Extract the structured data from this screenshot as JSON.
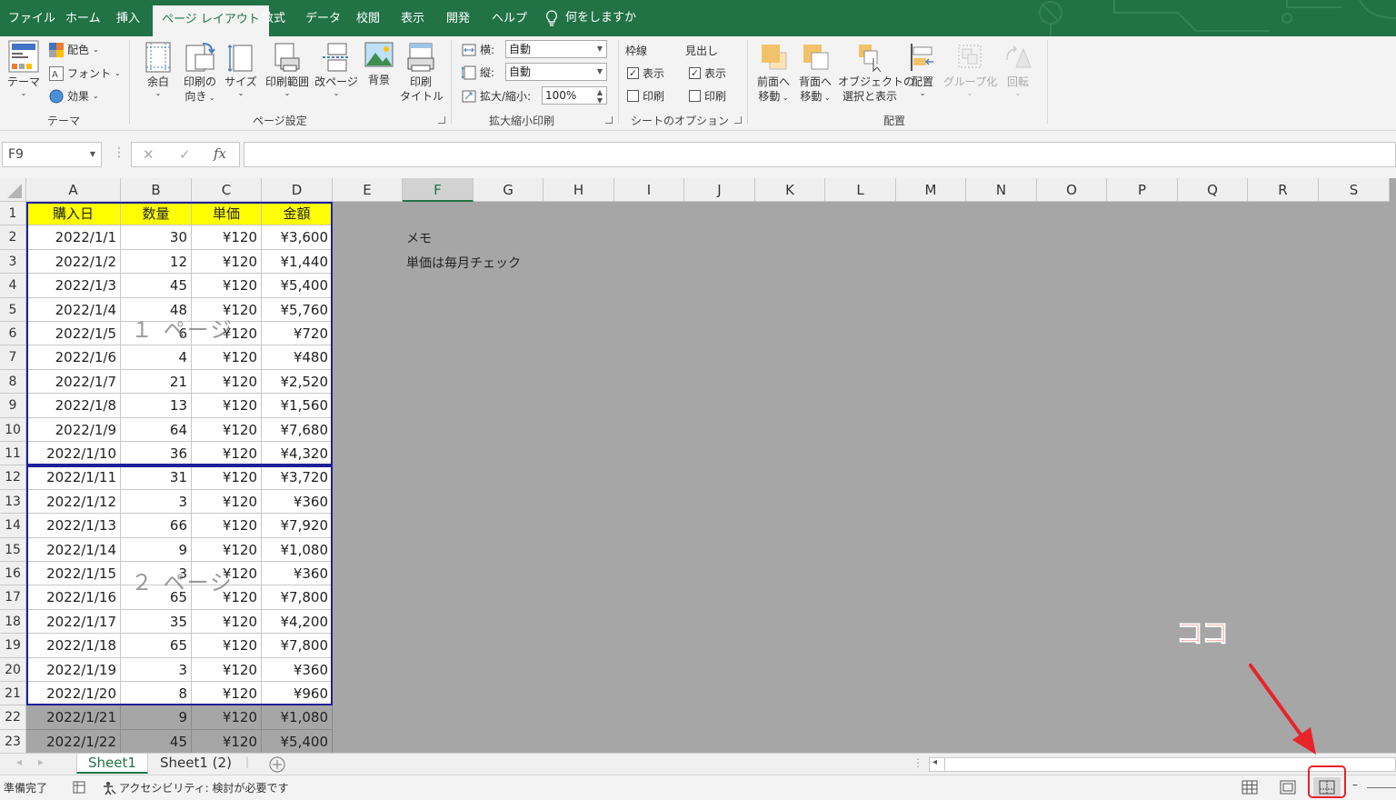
{
  "tabs": [
    "ファイル",
    "ホーム",
    "挿入",
    "ページ レイアウト",
    "数式",
    "データ",
    "校閲",
    "表示",
    "開発",
    "ヘルプ"
  ],
  "tell_me": "何をしますか",
  "ribbon": {
    "theme": {
      "themes": "テーマ",
      "colors": "配色",
      "fonts": "フォント",
      "effects": "効果",
      "group": "テーマ"
    },
    "page_setup": {
      "margins": "余白",
      "orientation_1": "印刷の",
      "orientation_2": "向き",
      "size": "サイズ",
      "print_area": "印刷範囲",
      "breaks": "改ページ",
      "background": "背景",
      "print_titles_1": "印刷",
      "print_titles_2": "タイトル",
      "group": "ページ設定"
    },
    "scale": {
      "width_label": "横:",
      "width_value": "自動",
      "height_label": "縦:",
      "height_value": "自動",
      "scale_label": "拡大/縮小:",
      "scale_value": "100%",
      "group": "拡大縮小印刷"
    },
    "sheet_options": {
      "gridlines": "枠線",
      "headings": "見出し",
      "view": "表示",
      "print": "印刷",
      "group": "シートのオプション"
    },
    "arrange": {
      "bring_forward_1": "前面へ",
      "bring_forward_2": "移動",
      "send_backward_1": "背面へ",
      "send_backward_2": "移動",
      "selection_pane_1": "オブジェクトの",
      "selection_pane_2": "選択と表示",
      "align": "配置",
      "group_btn": "グループ化",
      "rotate": "回転",
      "group": "配置"
    }
  },
  "formula_bar": {
    "name_box": "F9",
    "cancel": "✕",
    "enter": "✓",
    "fx": "fx",
    "formula": ""
  },
  "columns": [
    "A",
    "B",
    "C",
    "D",
    "E",
    "F",
    "G",
    "H",
    "I",
    "J",
    "K",
    "L",
    "M",
    "N",
    "O",
    "P",
    "Q",
    "R",
    "S"
  ],
  "selected_column": "F",
  "table": {
    "headers": [
      "購入日",
      "数量",
      "単価",
      "金額"
    ],
    "rows": [
      [
        "2022/1/1",
        "30",
        "¥120",
        "¥3,600"
      ],
      [
        "2022/1/2",
        "12",
        "¥120",
        "¥1,440"
      ],
      [
        "2022/1/3",
        "45",
        "¥120",
        "¥5,400"
      ],
      [
        "2022/1/4",
        "48",
        "¥120",
        "¥5,760"
      ],
      [
        "2022/1/5",
        "6",
        "¥120",
        "¥720"
      ],
      [
        "2022/1/6",
        "4",
        "¥120",
        "¥480"
      ],
      [
        "2022/1/7",
        "21",
        "¥120",
        "¥2,520"
      ],
      [
        "2022/1/8",
        "13",
        "¥120",
        "¥1,560"
      ],
      [
        "2022/1/9",
        "64",
        "¥120",
        "¥7,680"
      ],
      [
        "2022/1/10",
        "36",
        "¥120",
        "¥4,320"
      ],
      [
        "2022/1/11",
        "31",
        "¥120",
        "¥3,720"
      ],
      [
        "2022/1/12",
        "3",
        "¥120",
        "¥360"
      ],
      [
        "2022/1/13",
        "66",
        "¥120",
        "¥7,920"
      ],
      [
        "2022/1/14",
        "9",
        "¥120",
        "¥1,080"
      ],
      [
        "2022/1/15",
        "3",
        "¥120",
        "¥360"
      ],
      [
        "2022/1/16",
        "65",
        "¥120",
        "¥7,800"
      ],
      [
        "2022/1/17",
        "35",
        "¥120",
        "¥4,200"
      ],
      [
        "2022/1/18",
        "65",
        "¥120",
        "¥7,800"
      ],
      [
        "2022/1/19",
        "3",
        "¥120",
        "¥360"
      ],
      [
        "2022/1/20",
        "8",
        "¥120",
        "¥960"
      ],
      [
        "2022/1/21",
        "9",
        "¥120",
        "¥1,080"
      ],
      [
        "2022/1/22",
        "45",
        "¥120",
        "¥5,400"
      ]
    ]
  },
  "page_watermarks": [
    "１ ページ",
    "２ ページ"
  ],
  "memo": [
    "メモ",
    "単価は毎月チェック"
  ],
  "sheets": [
    "Sheet1",
    "Sheet1 (2)"
  ],
  "status": {
    "ready": "準備完了",
    "accessibility": "アクセシビリティ: 検討が必要です"
  },
  "annotation": "ココ",
  "colors": {
    "excel_green": "#217346",
    "header_fill": "#ffff00",
    "page_border": "#1f1f9a",
    "annotation_red": "#e8232a"
  }
}
